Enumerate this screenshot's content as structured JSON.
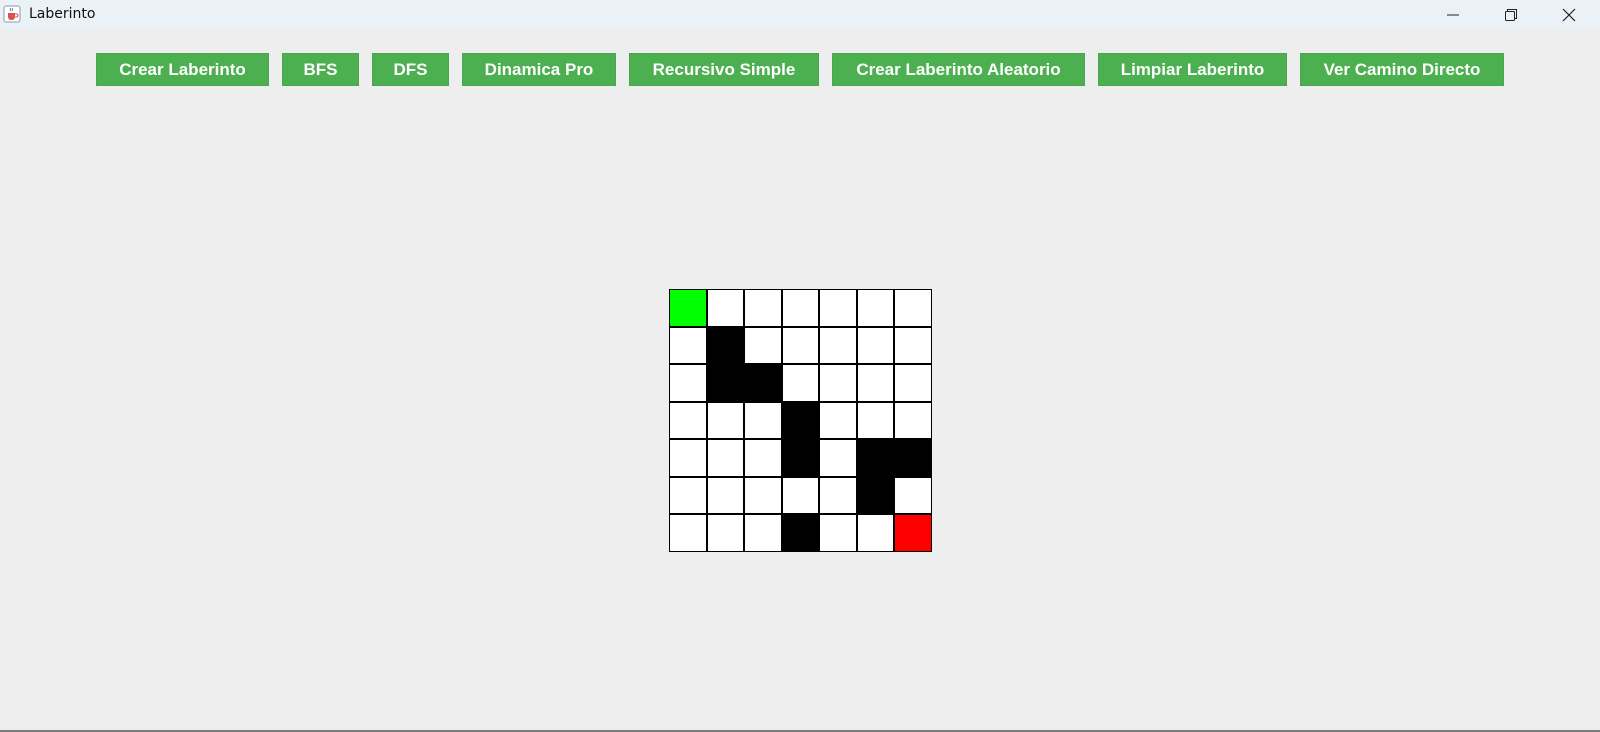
{
  "window": {
    "title": "Laberinto",
    "icon": "java-cup-icon",
    "controls": [
      "minimize-icon",
      "restore-icon",
      "close-icon"
    ]
  },
  "toolbar": {
    "buttons": [
      {
        "label": "Crear Laberinto"
      },
      {
        "label": "BFS"
      },
      {
        "label": "DFS"
      },
      {
        "label": "Dinamica Pro"
      },
      {
        "label": "Recursivo Simple"
      },
      {
        "label": "Crear Laberinto Aleatorio"
      },
      {
        "label": "Limpiar Laberinto"
      },
      {
        "label": "Ver Camino Directo"
      }
    ],
    "button_color": "#4caf50"
  },
  "maze": {
    "rows": 7,
    "cols": 7,
    "grid": [
      [
        "S",
        ".",
        ".",
        ".",
        ".",
        ".",
        "."
      ],
      [
        ".",
        "#",
        ".",
        ".",
        ".",
        ".",
        "."
      ],
      [
        ".",
        "#",
        "#",
        ".",
        ".",
        ".",
        "."
      ],
      [
        ".",
        ".",
        ".",
        "#",
        ".",
        ".",
        "."
      ],
      [
        ".",
        ".",
        ".",
        "#",
        ".",
        "#",
        "#"
      ],
      [
        ".",
        ".",
        ".",
        ".",
        ".",
        "#",
        "."
      ],
      [
        ".",
        ".",
        ".",
        "#",
        ".",
        ".",
        "E"
      ]
    ],
    "colors": {
      "start": "#00ff00",
      "end": "#ff0000",
      "wall": "#000000",
      "open": "#ffffff"
    }
  }
}
